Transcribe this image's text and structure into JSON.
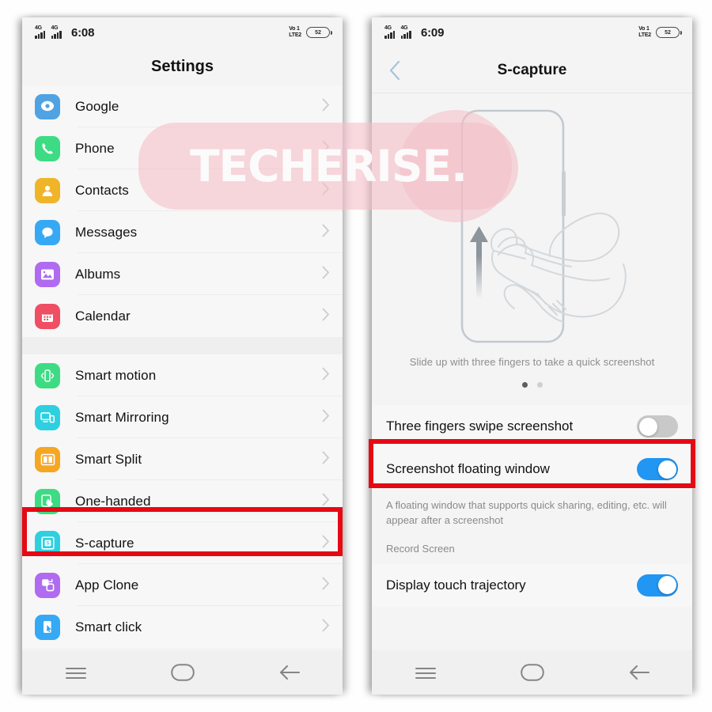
{
  "watermark": {
    "text": "TECHERISE."
  },
  "left_phone": {
    "statusbar": {
      "network_1": "4G",
      "network_2": "4G",
      "time": "6:08",
      "volte_line1": "Vo 1",
      "volte_line2": "LTE2",
      "battery": "52"
    },
    "title": "Settings",
    "items_group_1": [
      {
        "label": "Google",
        "icon": "google-icon",
        "color": "#4fa3e3"
      },
      {
        "label": "Phone",
        "icon": "phone-icon",
        "color": "#3ddc84"
      },
      {
        "label": "Contacts",
        "icon": "contacts-icon",
        "color": "#f0b429"
      },
      {
        "label": "Messages",
        "icon": "messages-icon",
        "color": "#36a9f4"
      },
      {
        "label": "Albums",
        "icon": "albums-icon",
        "color": "#b06bf0"
      },
      {
        "label": "Calendar",
        "icon": "calendar-icon",
        "color": "#ef4e63"
      }
    ],
    "items_group_2": [
      {
        "label": "Smart motion",
        "icon": "smart-motion-icon",
        "color": "#3ddc84"
      },
      {
        "label": "Smart Mirroring",
        "icon": "smart-mirroring-icon",
        "color": "#2ed0e0"
      },
      {
        "label": "Smart Split",
        "icon": "smart-split-icon",
        "color": "#f5a623"
      },
      {
        "label": "One-handed",
        "icon": "one-handed-icon",
        "color": "#3ddc84"
      },
      {
        "label": "S-capture",
        "icon": "s-capture-icon",
        "color": "#2ed0e0"
      },
      {
        "label": "App Clone",
        "icon": "app-clone-icon",
        "color": "#b06bf0"
      },
      {
        "label": "Smart click",
        "icon": "smart-click-icon",
        "color": "#36a9f4"
      }
    ],
    "navbar": {
      "menu": "menu-icon",
      "home": "home-icon",
      "back": "back-icon"
    }
  },
  "right_phone": {
    "statusbar": {
      "network_1": "4G",
      "network_2": "4G",
      "time": "6:09",
      "volte_line1": "Vo 1",
      "volte_line2": "LTE2",
      "battery": "52"
    },
    "title": "S-capture",
    "hero_caption": "Slide up with three fingers to take a quick screenshot",
    "page_dots": {
      "count": 2,
      "active": 0
    },
    "settings": [
      {
        "label": "Three fingers swipe screenshot",
        "toggle": "off"
      },
      {
        "label": "Screenshot floating window",
        "toggle": "on"
      }
    ],
    "description": "A floating window that supports quick sharing, editing, etc. will appear after a screenshot",
    "section_header": "Record Screen",
    "settings2": [
      {
        "label": "Display touch trajectory",
        "toggle": "on"
      }
    ],
    "navbar": {
      "menu": "menu-icon",
      "home": "home-icon",
      "back": "back-icon"
    }
  },
  "highlights": {
    "left_box_target": "S-capture",
    "right_box_target": "Three fingers swipe screenshot",
    "color": "#e50914"
  }
}
